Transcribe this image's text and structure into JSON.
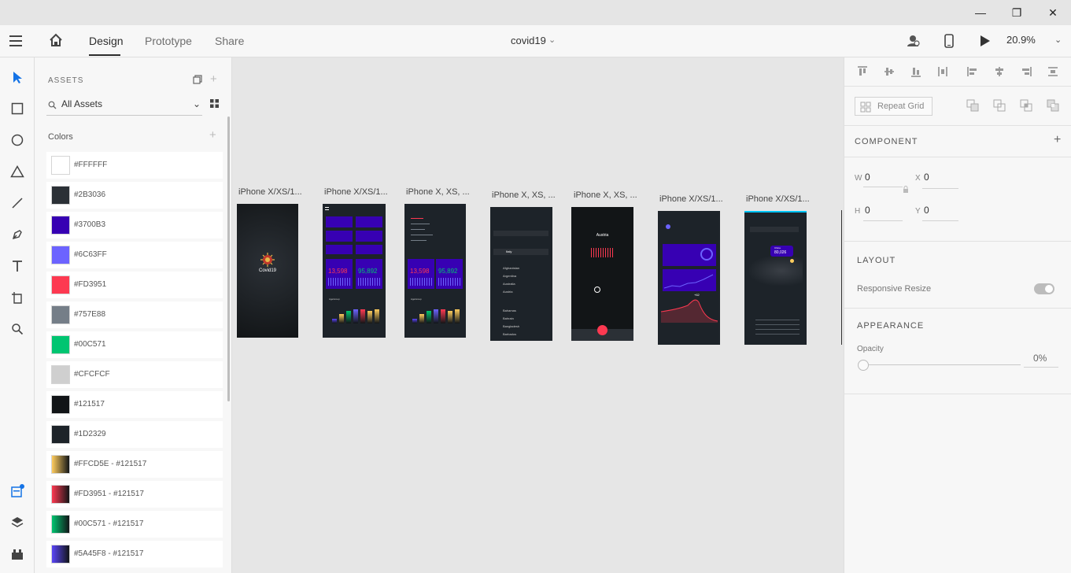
{
  "window": {
    "minimize": "—",
    "maximize": "❐",
    "close": "✕"
  },
  "topbar": {
    "tabs": [
      "Design",
      "Prototype",
      "Share"
    ],
    "document_title": "covid19",
    "zoom": "20.9%"
  },
  "assets": {
    "title": "ASSETS",
    "search_value": "All Assets",
    "colors_label": "Colors",
    "colors": [
      {
        "label": "#FFFFFF",
        "fill": "#FFFFFF"
      },
      {
        "label": "#2B3036",
        "fill": "#2B3036"
      },
      {
        "label": "#3700B3",
        "fill": "#3700B3"
      },
      {
        "label": "#6C63FF",
        "fill": "#6C63FF"
      },
      {
        "label": "#FD3951",
        "fill": "#FD3951"
      },
      {
        "label": "#757E88",
        "fill": "#757E88"
      },
      {
        "label": "#00C571",
        "fill": "#00C571"
      },
      {
        "label": "#CFCFCF",
        "fill": "#CFCFCF"
      },
      {
        "label": "#121517",
        "fill": "#121517"
      },
      {
        "label": "#1D2329",
        "fill": "#1D2329"
      },
      {
        "label": "#FFCD5E - #121517",
        "fill": "linear-gradient(90deg,#FFCD5E,#121517)"
      },
      {
        "label": "#FD3951 - #121517",
        "fill": "linear-gradient(90deg,#FD3951,#121517)"
      },
      {
        "label": "#00C571 - #121517",
        "fill": "linear-gradient(90deg,#00C571,#121517)"
      },
      {
        "label": "#5A45F8 - #121517",
        "fill": "linear-gradient(90deg,#5A45F8,#121517)"
      }
    ]
  },
  "artboards": [
    {
      "label": "iPhone X/XS/1...",
      "splash_text": "Covid19"
    },
    {
      "label": "iPhone X/XS/1...",
      "stat_left": "13,598",
      "stat_right": "95,892",
      "chart_title": "AgeGroup"
    },
    {
      "label": "iPhone X, XS, ...",
      "stat_left": "13,598",
      "stat_right": "95,892",
      "chart_title": "AgeGroup"
    },
    {
      "label": "iPhone X, XS, ...",
      "countries": [
        "Italy",
        "Afghanistan",
        "Argentina",
        "Australia",
        "Austria",
        "Bahamas",
        "Bahrain",
        "Bangladesh",
        "Barbados"
      ]
    },
    {
      "label": "iPhone X, XS, ...",
      "country": "Austria"
    },
    {
      "label": "iPhone X/XS/1...",
      "chart_value": "+62"
    },
    {
      "label": "iPhone X/XS/1...",
      "bubble_country": "China",
      "bubble_value": "80,026"
    }
  ],
  "props": {
    "repeat_grid": "Repeat Grid",
    "component_title": "COMPONENT",
    "w_label": "W",
    "w_value": "0",
    "x_label": "X",
    "x_value": "0",
    "h_label": "H",
    "h_value": "0",
    "y_label": "Y",
    "y_value": "0",
    "layout_title": "LAYOUT",
    "responsive_label": "Responsive Resize",
    "appearance_title": "APPEARANCE",
    "opacity_label": "Opacity",
    "opacity_value": "0%"
  }
}
